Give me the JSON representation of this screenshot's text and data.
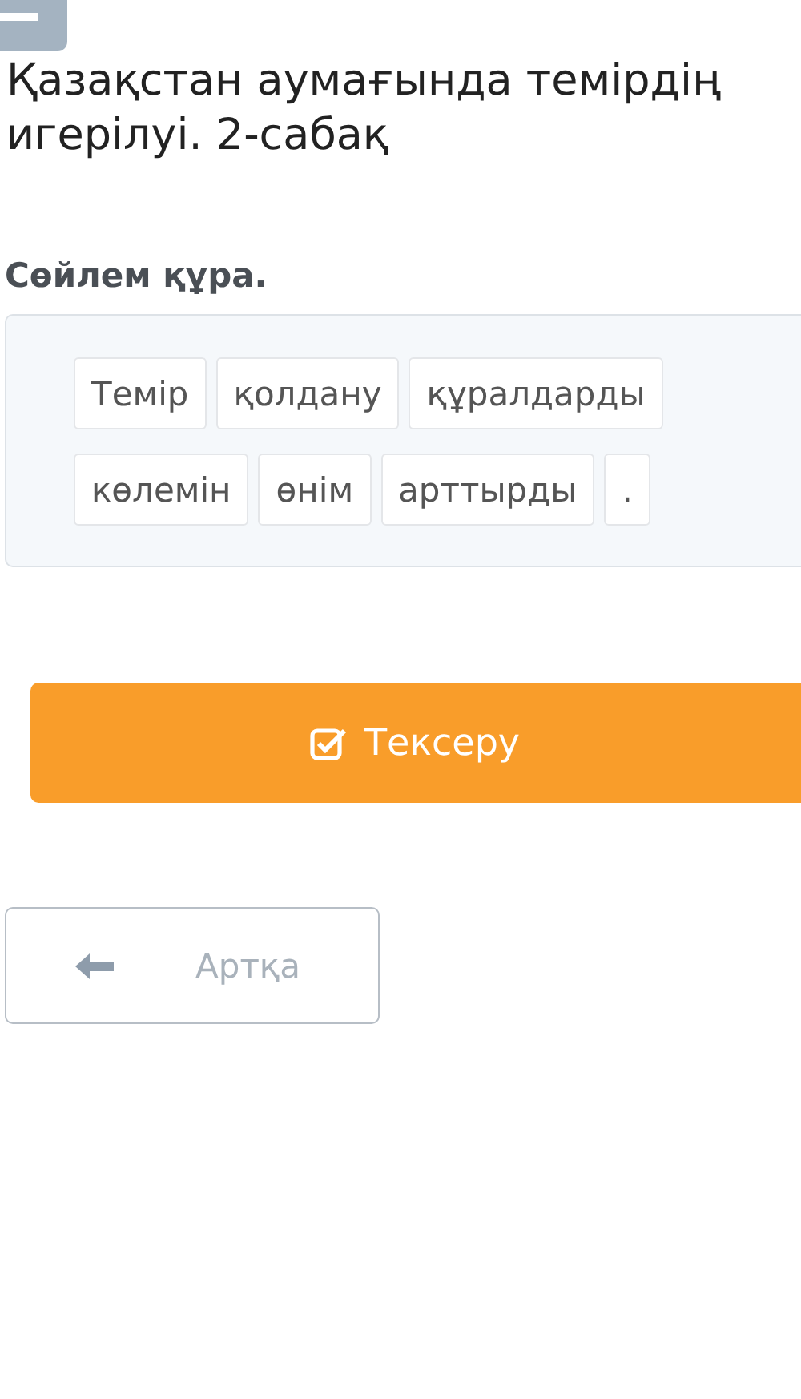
{
  "title": "Қазақстан аумағында темірдің игерілуі. 2-сабақ",
  "instruction": "Сөйлем құра.",
  "words": [
    "Темір",
    "қолдану",
    "құралдарды",
    "көлемін",
    "өнім",
    "арттырды",
    "."
  ],
  "check_button": {
    "label": "Тексеру"
  },
  "back_button": {
    "label": "Артқа"
  }
}
